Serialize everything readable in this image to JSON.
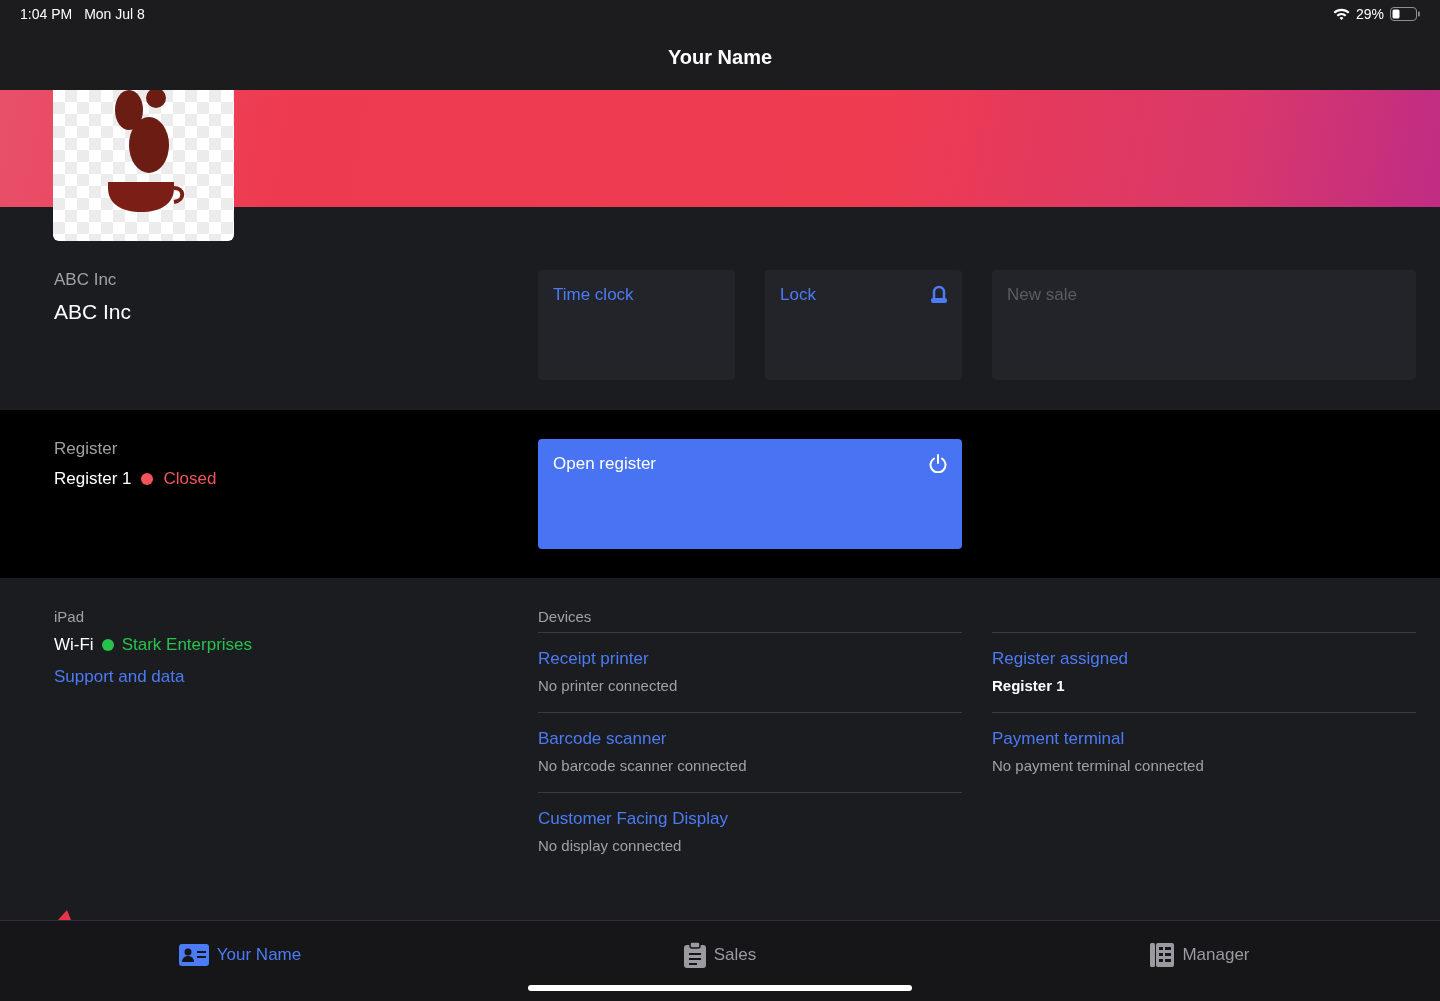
{
  "status_bar": {
    "time": "1:04 PM",
    "date": "Mon Jul 8",
    "battery": "29%"
  },
  "nav": {
    "title": "Your Name"
  },
  "company": {
    "label": "ABC Inc",
    "name": "ABC Inc"
  },
  "tiles": [
    {
      "label": "Time clock",
      "kind": "plain",
      "disabled": false
    },
    {
      "label": "Lock",
      "kind": "lock",
      "disabled": false
    },
    {
      "label": "New sale",
      "kind": "plain",
      "disabled": true
    }
  ],
  "register": {
    "label": "Register",
    "name": "Register 1",
    "status": "Closed",
    "color": "#f2545b"
  },
  "register_action": {
    "label": "Open register"
  },
  "ipad": {
    "label": "iPad",
    "wifi_label": "Wi-Fi",
    "network": "Stark Enterprises",
    "color": "#27c24c",
    "support_link": "Support and data"
  },
  "devices": {
    "header": "Devices",
    "left": [
      {
        "title": "Receipt printer",
        "detail": "No printer connected",
        "kind": "status"
      },
      {
        "title": "Barcode scanner",
        "detail": "No barcode scanner connected",
        "kind": "status"
      },
      {
        "title": "Customer Facing Display",
        "detail": "No display connected",
        "kind": "status"
      }
    ],
    "right": [
      {
        "title": "Register assigned",
        "detail": "Register 1",
        "kind": "value"
      },
      {
        "title": "Payment terminal",
        "detail": "No payment terminal connected",
        "kind": "status"
      }
    ]
  },
  "tabs": [
    {
      "label": "Your Name",
      "kind": "profile",
      "selected": true
    },
    {
      "label": "Sales",
      "kind": "clipboard",
      "selected": false
    },
    {
      "label": "Manager",
      "kind": "ledger",
      "selected": false
    }
  ]
}
